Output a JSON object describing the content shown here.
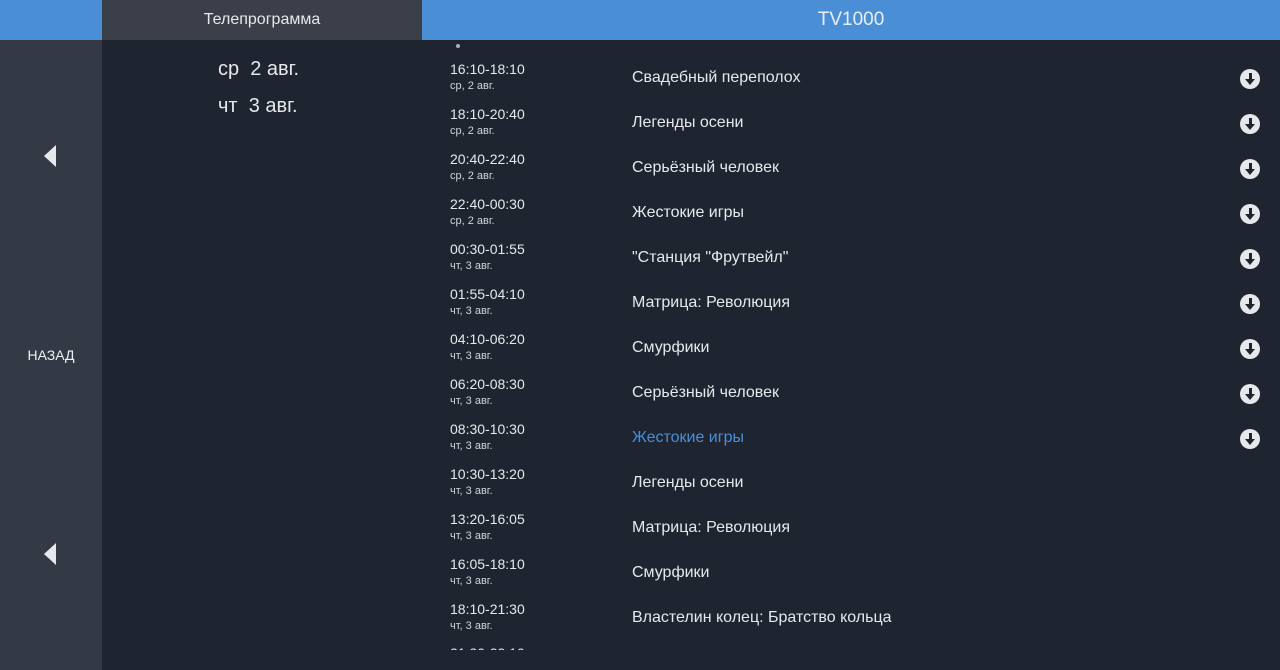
{
  "header": {
    "tab_program": "Телепрограмма",
    "channel": "TV1000"
  },
  "rail": {
    "back_label": "НАЗАД"
  },
  "dates": [
    "ср  2 авг.",
    "чт  3 авг."
  ],
  "schedule": [
    {
      "time": "16:10-18:10",
      "date": "ср, 2 авг.",
      "title": "Свадебный переполох",
      "download": true
    },
    {
      "time": "18:10-20:40",
      "date": "ср, 2 авг.",
      "title": "Легенды осени",
      "download": true
    },
    {
      "time": "20:40-22:40",
      "date": "ср, 2 авг.",
      "title": "Серьёзный человек",
      "download": true
    },
    {
      "time": "22:40-00:30",
      "date": "ср, 2 авг.",
      "title": "Жестокие игры",
      "download": true
    },
    {
      "time": "00:30-01:55",
      "date": "чт, 3 авг.",
      "title": "\"Станция \"Фрутвейл\"",
      "download": true
    },
    {
      "time": "01:55-04:10",
      "date": "чт, 3 авг.",
      "title": "Матрица: Революция",
      "download": true
    },
    {
      "time": "04:10-06:20",
      "date": "чт, 3 авг.",
      "title": "Смурфики",
      "download": true
    },
    {
      "time": "06:20-08:30",
      "date": "чт, 3 авг.",
      "title": "Серьёзный человек",
      "download": true
    },
    {
      "time": "08:30-10:30",
      "date": "чт, 3 авг.",
      "title": "Жестокие игры",
      "download": true,
      "current": true
    },
    {
      "time": "10:30-13:20",
      "date": "чт, 3 авг.",
      "title": "Легенды осени",
      "download": false
    },
    {
      "time": "13:20-16:05",
      "date": "чт, 3 авг.",
      "title": "Матрица: Революция",
      "download": false
    },
    {
      "time": "16:05-18:10",
      "date": "чт, 3 авг.",
      "title": "Смурфики",
      "download": false
    },
    {
      "time": "18:10-21:30",
      "date": "чт, 3 авг.",
      "title": "Властелин колец: Братство кольца",
      "download": false
    }
  ],
  "colors": {
    "accent": "#4a8fd6",
    "background": "#1f2530",
    "rail": "#343a45",
    "tab": "#3a3f4a"
  },
  "icons": {
    "rail_arrow": "chevron-left-icon",
    "row_action": "download-circle-icon"
  }
}
